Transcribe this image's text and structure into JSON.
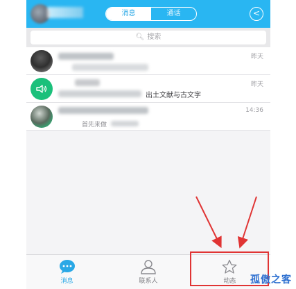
{
  "header": {
    "tabs": [
      {
        "label": "消息",
        "active": true
      },
      {
        "label": "通话",
        "active": false
      }
    ],
    "back_icon": "back-circle-icon"
  },
  "search": {
    "icon": "search-icon",
    "placeholder": "搜索"
  },
  "conversations": [
    {
      "time": "昨天",
      "preview": "",
      "icon": "avatar-icon"
    },
    {
      "time": "昨天",
      "preview": "出土文献与古文字",
      "icon": "speaker-icon"
    },
    {
      "time": "14:36",
      "preview": "首先来做",
      "icon": "avatar-icon"
    }
  ],
  "tabbar": {
    "items": [
      {
        "label": "消息",
        "icon": "chat-bubble-icon",
        "active": true
      },
      {
        "label": "联系人",
        "icon": "contacts-icon",
        "active": false
      },
      {
        "label": "动态",
        "icon": "star-icon",
        "active": false
      }
    ]
  },
  "watermark": "孤傲之客",
  "colors": {
    "header": "#29b6f2",
    "accent": "#2aa8e6",
    "highlight": "#e03434",
    "watermark": "#2d6fd0"
  }
}
